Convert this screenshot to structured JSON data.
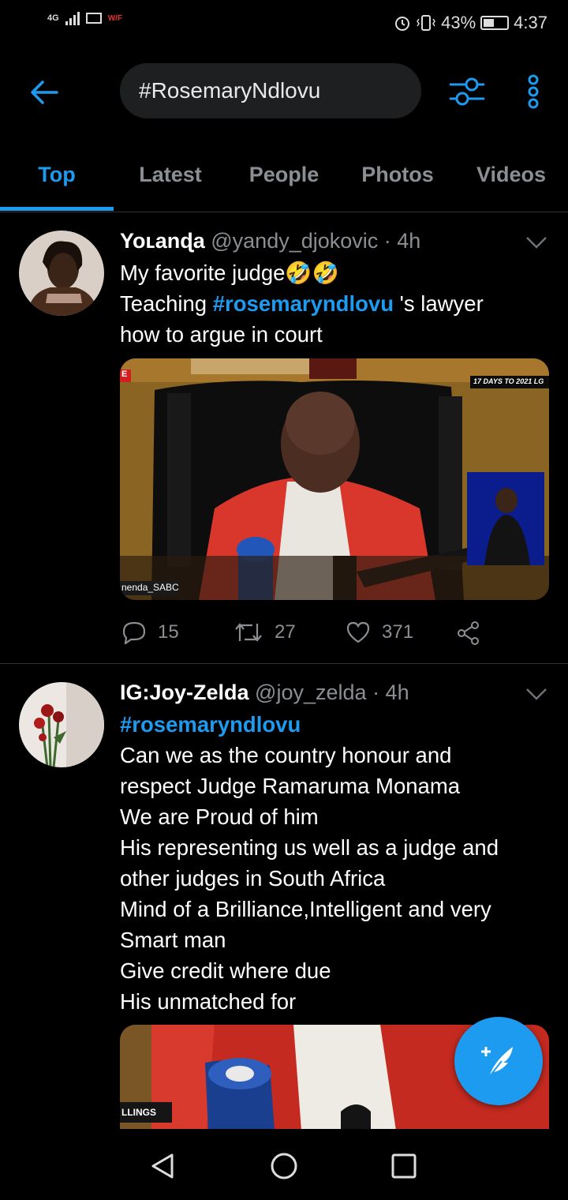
{
  "status_bar": {
    "network": "4G",
    "wifi_label": "W/F",
    "battery": "43%",
    "time": "4:37"
  },
  "header": {
    "search_query": "#RosemaryNdlovu"
  },
  "tabs": [
    {
      "label": "Top",
      "active": true
    },
    {
      "label": "Latest",
      "active": false
    },
    {
      "label": "People",
      "active": false
    },
    {
      "label": "Photos",
      "active": false
    },
    {
      "label": "Videos",
      "active": false
    }
  ],
  "tweets": [
    {
      "name": "Yoʟanɖa",
      "handle": "@yandy_djokovic",
      "time": "· 4h",
      "lines": [
        "My favorite judge🤣🤣"
      ],
      "line2_prefix": "Teaching ",
      "line2_hashtag": "#rosemaryndlovu",
      "line2_suffix": " 's lawyer",
      "line3": "how to argue in court",
      "media": {
        "banner": "17 DAYS TO 2021 LG",
        "channel_tag": "nenda_SABC",
        "channel_corner": "E"
      },
      "replies": "15",
      "retweets": "27",
      "likes": "371"
    },
    {
      "name": "IG:Joy-Zelda",
      "handle": "@joy_zelda",
      "time": "· 4h",
      "hashtag": "#rosemaryndlovu",
      "lines": [
        "Can we as the country honour and",
        "respect Judge Ramaruma Monama",
        "We are Proud of him",
        "His representing us well as a judge and",
        "other judges in South Africa",
        "Mind of a Brilliance,Intelligent and very",
        "Smart man",
        "Give credit where due",
        "His unmatched for"
      ],
      "media": {
        "channel_tag": "LLINGS"
      }
    }
  ],
  "colors": {
    "accent": "#1d9bf0",
    "background": "#000000",
    "muted": "#8b8f93"
  }
}
